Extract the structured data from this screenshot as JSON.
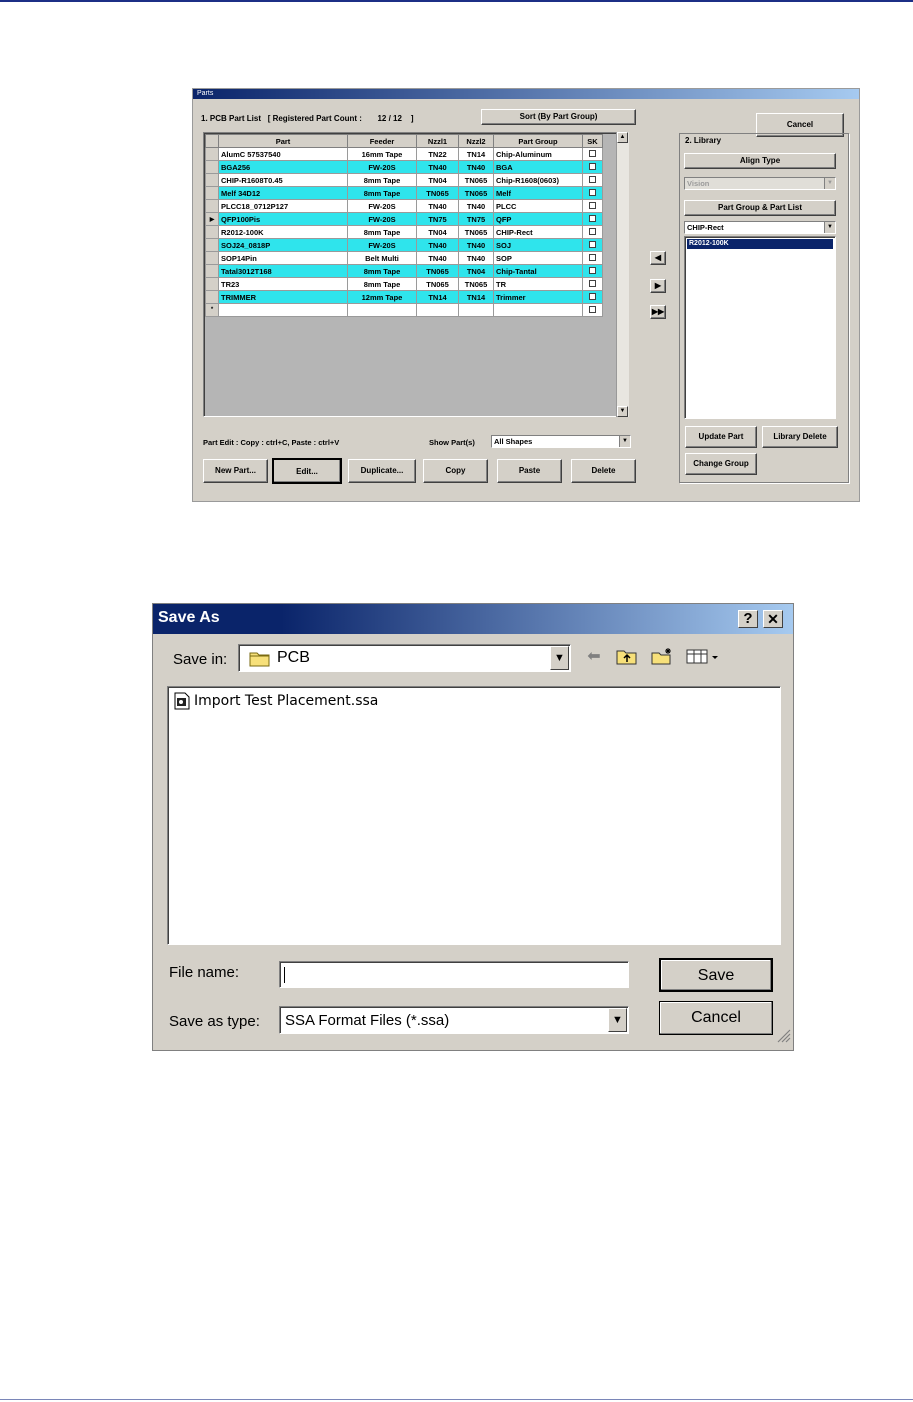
{
  "parts": {
    "title": "Parts",
    "list_heading": "1. PCB Part List",
    "registered_label": "[ Registered Part Count :",
    "registered_value": "12 / 12",
    "registered_end": "]",
    "sort_button": "Sort (By Part Group)",
    "cancel_button": "Cancel",
    "columns": [
      "Part",
      "Feeder",
      "Nzzl1",
      "Nzzl2",
      "Part Group",
      "SK"
    ],
    "rows": [
      {
        "part": "AlumC 57537540",
        "feeder": "16mm Tape",
        "n1": "TN22",
        "n2": "TN14",
        "group": "Chip-Aluminum",
        "hl": false
      },
      {
        "part": "BGA256",
        "feeder": "FW-20S",
        "n1": "TN40",
        "n2": "TN40",
        "group": "BGA",
        "hl": true
      },
      {
        "part": "CHIP-R1608T0.45",
        "feeder": "8mm Tape",
        "n1": "TN04",
        "n2": "TN065",
        "group": "Chip-R1608(0603)",
        "hl": false
      },
      {
        "part": "Melf 34D12",
        "feeder": "8mm Tape",
        "n1": "TN065",
        "n2": "TN065",
        "group": "Melf",
        "hl": true
      },
      {
        "part": "PLCC18_0712P127",
        "feeder": "FW-20S",
        "n1": "TN40",
        "n2": "TN40",
        "group": "PLCC",
        "hl": false
      },
      {
        "part": "QFP100Pis",
        "feeder": "FW-20S",
        "n1": "TN75",
        "n2": "TN75",
        "group": "QFP",
        "hl": true,
        "current": true
      },
      {
        "part": "R2012-100K",
        "feeder": "8mm Tape",
        "n1": "TN04",
        "n2": "TN065",
        "group": "CHIP-Rect",
        "hl": false
      },
      {
        "part": "SOJ24_0818P",
        "feeder": "FW-20S",
        "n1": "TN40",
        "n2": "TN40",
        "group": "SOJ",
        "hl": true
      },
      {
        "part": "SOP14Pin",
        "feeder": "Belt Multi",
        "n1": "TN40",
        "n2": "TN40",
        "group": "SOP",
        "hl": false
      },
      {
        "part": "Tatal3012T168",
        "feeder": "8mm Tape",
        "n1": "TN065",
        "n2": "TN04",
        "group": "Chip-Tantal",
        "hl": true
      },
      {
        "part": "TR23",
        "feeder": "8mm Tape",
        "n1": "TN065",
        "n2": "TN065",
        "group": "TR",
        "hl": false
      },
      {
        "part": "TRIMMER",
        "feeder": "12mm Tape",
        "n1": "TN14",
        "n2": "TN14",
        "group": "Trimmer",
        "hl": true
      }
    ],
    "new_row_marker": "*",
    "edit_hint": "Part Edit : Copy : ctrl+C,  Paste : ctrl+V",
    "show_parts_label": "Show Part(s)",
    "show_parts_value": "All Shapes",
    "buttons": {
      "new_part": "New Part...",
      "edit": "Edit...",
      "duplicate": "Duplicate...",
      "copy": "Copy",
      "paste": "Paste",
      "delete": "Delete"
    },
    "library": {
      "heading": "2. Library",
      "align_type_label": "Align Type",
      "align_type_value": "Vision",
      "part_group_label": "Part Group & Part List",
      "part_group_value": "CHIP-Rect",
      "selected_item": "R2012-100K",
      "update_part": "Update Part",
      "library_delete": "Library Delete",
      "change_group": "Change Group"
    }
  },
  "save_as": {
    "title": "Save As",
    "help_glyph": "?",
    "close_glyph": "✕",
    "save_in_label": "Save in:",
    "save_in_value": "PCB",
    "files": [
      "Import Test Placement.ssa"
    ],
    "file_name_label": "File name:",
    "file_name_value": "",
    "save_type_label": "Save as type:",
    "save_type_value": "SSA Format Files (*.ssa)",
    "save_button": "Save",
    "cancel_button": "Cancel"
  }
}
